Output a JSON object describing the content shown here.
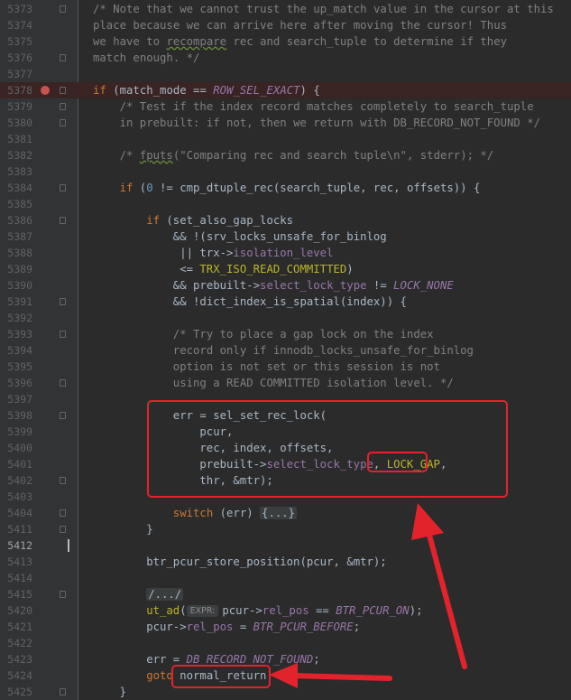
{
  "annotation_color": "#e3232c",
  "breakpoint_line": "5378",
  "current_line": "5412",
  "lines": [
    {
      "n": "5373",
      "indent": 0,
      "fold": true,
      "t": [
        {
          "c": "cm",
          "v": "/* Note that we cannot trust the up_match value in the cursor at this"
        }
      ]
    },
    {
      "n": "5374",
      "indent": 0,
      "t": [
        {
          "c": "cm",
          "v": "place because we can arrive here after moving the cursor! Thus"
        }
      ]
    },
    {
      "n": "5375",
      "indent": 0,
      "t": [
        {
          "c": "cm",
          "v": "we have to "
        },
        {
          "c": "cm und",
          "v": "recompare"
        },
        {
          "c": "cm",
          "v": " rec and search_tuple to determine if they"
        }
      ]
    },
    {
      "n": "5376",
      "indent": 0,
      "fold": true,
      "t": [
        {
          "c": "cm",
          "v": "match enough. */"
        }
      ]
    },
    {
      "n": "5377",
      "indent": 0,
      "t": []
    },
    {
      "n": "5378",
      "indent": 0,
      "fold": true,
      "t": [
        {
          "c": "kw",
          "v": "if"
        },
        {
          "c": "",
          "v": " (match_mode == "
        },
        {
          "c": "mac",
          "v": "ROW_SEL_EXACT"
        },
        {
          "c": "",
          "v": ") {"
        }
      ]
    },
    {
      "n": "5379",
      "indent": 4,
      "fold": true,
      "t": [
        {
          "c": "cm",
          "v": "/* Test if the index record matches completely to search_tuple"
        }
      ]
    },
    {
      "n": "5380",
      "indent": 4,
      "fold": true,
      "t": [
        {
          "c": "cm",
          "v": "in prebuilt: if not, then we return with DB_RECORD_NOT_FOUND */"
        }
      ]
    },
    {
      "n": "5381",
      "indent": 0,
      "t": []
    },
    {
      "n": "5382",
      "indent": 4,
      "t": [
        {
          "c": "cm",
          "v": "/* "
        },
        {
          "c": "cm und",
          "v": "fputs"
        },
        {
          "c": "cm",
          "v": "(\"Comparing rec and search tuple\\n\", stderr); */"
        }
      ]
    },
    {
      "n": "5383",
      "indent": 0,
      "t": []
    },
    {
      "n": "5384",
      "indent": 4,
      "fold": true,
      "t": [
        {
          "c": "kw",
          "v": "if"
        },
        {
          "c": "",
          "v": " ("
        },
        {
          "c": "num",
          "v": "0"
        },
        {
          "c": "",
          "v": " != cmp_dtuple_rec(search_tuple, rec, offsets)) {"
        }
      ]
    },
    {
      "n": "5385",
      "indent": 0,
      "t": []
    },
    {
      "n": "5386",
      "indent": 8,
      "fold": true,
      "t": [
        {
          "c": "kw",
          "v": "if"
        },
        {
          "c": "",
          "v": " (set_also_gap_locks"
        }
      ]
    },
    {
      "n": "5387",
      "indent": 12,
      "t": [
        {
          "c": "",
          "v": "&& !(srv_locks_unsafe_for_binlog"
        }
      ]
    },
    {
      "n": "5388",
      "indent": 13,
      "t": [
        {
          "c": "",
          "v": "|| trx->"
        },
        {
          "c": "fld",
          "v": "isolation_level"
        }
      ]
    },
    {
      "n": "5389",
      "indent": 13,
      "t": [
        {
          "c": "",
          "v": "<= "
        },
        {
          "c": "grn",
          "v": "TRX_ISO_READ_COMMITTED"
        },
        {
          "c": "",
          "v": ")"
        }
      ]
    },
    {
      "n": "5390",
      "indent": 12,
      "t": [
        {
          "c": "",
          "v": "&& prebuilt->"
        },
        {
          "c": "fld",
          "v": "select_lock_type"
        },
        {
          "c": "",
          "v": " != "
        },
        {
          "c": "mac",
          "v": "LOCK_NONE"
        }
      ]
    },
    {
      "n": "5391",
      "indent": 12,
      "fold": true,
      "t": [
        {
          "c": "",
          "v": "&& !dict_index_is_spatial(index)) {"
        }
      ]
    },
    {
      "n": "5392",
      "indent": 0,
      "t": []
    },
    {
      "n": "5393",
      "indent": 12,
      "fold": true,
      "t": [
        {
          "c": "cm",
          "v": "/* Try to place a gap lock on the index"
        }
      ]
    },
    {
      "n": "5394",
      "indent": 12,
      "t": [
        {
          "c": "cm",
          "v": "record only if innodb_locks_unsafe_for_binlog"
        }
      ]
    },
    {
      "n": "5395",
      "indent": 12,
      "t": [
        {
          "c": "cm",
          "v": "option is not set or this session is not"
        }
      ]
    },
    {
      "n": "5396",
      "indent": 12,
      "fold": true,
      "t": [
        {
          "c": "cm",
          "v": "using a READ COMMITTED isolation level. */"
        }
      ]
    },
    {
      "n": "5397",
      "indent": 0,
      "t": []
    },
    {
      "n": "5398",
      "indent": 12,
      "fold": true,
      "t": [
        {
          "c": "",
          "v": "err = sel_set_rec_lock("
        }
      ]
    },
    {
      "n": "5399",
      "indent": 16,
      "t": [
        {
          "c": "",
          "v": "pcur,"
        }
      ]
    },
    {
      "n": "5400",
      "indent": 16,
      "t": [
        {
          "c": "",
          "v": "rec, index, offsets,"
        }
      ]
    },
    {
      "n": "5401",
      "indent": 16,
      "t": [
        {
          "c": "",
          "v": "prebuilt->"
        },
        {
          "c": "fld",
          "v": "select_lock_type"
        },
        {
          "c": "",
          "v": ", "
        },
        {
          "c": "grn",
          "v": "LOCK_GAP"
        },
        {
          "c": "",
          "v": ","
        }
      ]
    },
    {
      "n": "5402",
      "indent": 16,
      "fold": true,
      "t": [
        {
          "c": "",
          "v": "thr, &mtr);"
        }
      ]
    },
    {
      "n": "5403",
      "indent": 0,
      "t": []
    },
    {
      "n": "5404",
      "indent": 12,
      "fold": true,
      "t": [
        {
          "c": "kw",
          "v": "switch"
        },
        {
          "c": "",
          "v": " (err) "
        },
        {
          "c": "fold-ph",
          "v": "{...}"
        }
      ]
    },
    {
      "n": "5411",
      "indent": 8,
      "fold": true,
      "t": [
        {
          "c": "",
          "v": "}"
        }
      ]
    },
    {
      "n": "5412",
      "indent": 0,
      "t": []
    },
    {
      "n": "5413",
      "indent": 8,
      "t": [
        {
          "c": "",
          "v": "btr_pcur_store_position(pcur, &mtr);"
        }
      ]
    },
    {
      "n": "5414",
      "indent": 0,
      "t": []
    },
    {
      "n": "5415",
      "indent": 8,
      "fold": true,
      "t": [
        {
          "c": "cm fold-ph",
          "v": "/.../"
        }
      ]
    },
    {
      "n": "5420",
      "indent": 8,
      "t": [
        {
          "c": "grn",
          "v": "ut_ad"
        },
        {
          "c": "",
          "v": "("
        },
        {
          "c": "hint",
          "v": "EXPR:"
        },
        {
          "c": "",
          "v": "pcur->"
        },
        {
          "c": "fld",
          "v": "rel_pos"
        },
        {
          "c": "",
          "v": " == "
        },
        {
          "c": "mac",
          "v": "BTR_PCUR_ON"
        },
        {
          "c": "",
          "v": ");"
        }
      ]
    },
    {
      "n": "5421",
      "indent": 8,
      "t": [
        {
          "c": "",
          "v": "pcur->"
        },
        {
          "c": "fld",
          "v": "rel_pos"
        },
        {
          "c": "",
          "v": " = "
        },
        {
          "c": "mac",
          "v": "BTR_PCUR_BEFORE"
        },
        {
          "c": "",
          "v": ";"
        }
      ]
    },
    {
      "n": "5422",
      "indent": 0,
      "t": []
    },
    {
      "n": "5423",
      "indent": 8,
      "t": [
        {
          "c": "",
          "v": "err = "
        },
        {
          "c": "mac",
          "v": "DB_RECORD_NOT_FOUND"
        },
        {
          "c": "",
          "v": ";"
        }
      ]
    },
    {
      "n": "5424",
      "indent": 8,
      "t": [
        {
          "c": "kw",
          "v": "goto"
        },
        {
          "c": "",
          "v": " normal_return;"
        }
      ]
    },
    {
      "n": "5425",
      "indent": 4,
      "fold": true,
      "t": [
        {
          "c": "",
          "v": "}"
        }
      ]
    }
  ]
}
